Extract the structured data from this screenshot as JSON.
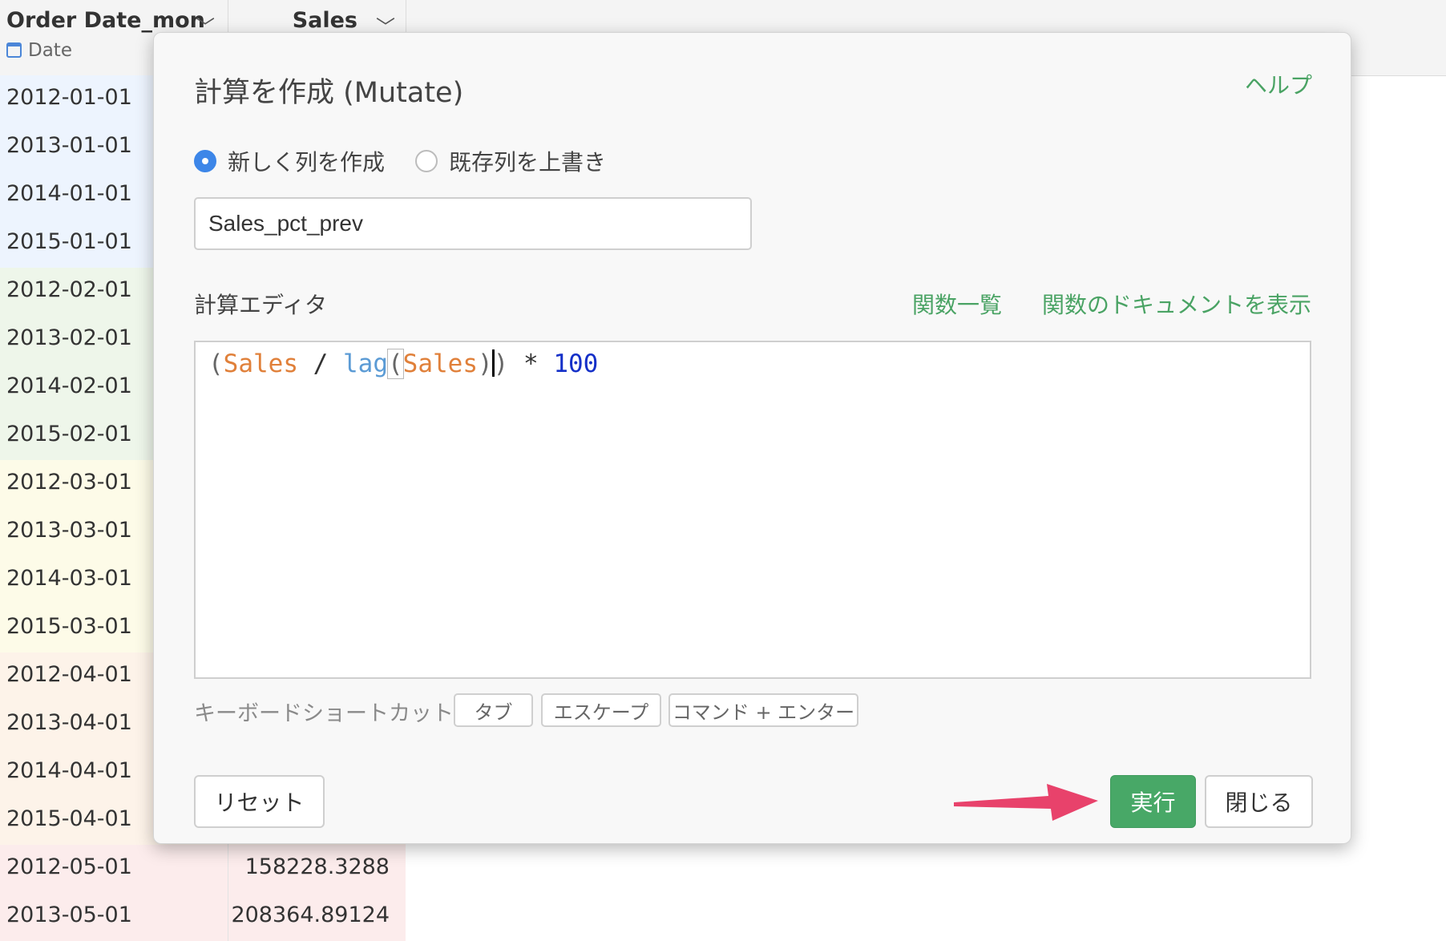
{
  "grid": {
    "columns": [
      {
        "name": "Order Date_mon",
        "type_label": "Date"
      },
      {
        "name": "Sales"
      }
    ],
    "rows": [
      {
        "date": "2012-01-01",
        "sales": "",
        "color": "#edf4fe"
      },
      {
        "date": "2013-01-01",
        "sales": "",
        "color": "#edf4fe"
      },
      {
        "date": "2014-01-01",
        "sales": "",
        "color": "#edf4fe"
      },
      {
        "date": "2015-01-01",
        "sales": "",
        "color": "#edf4fe"
      },
      {
        "date": "2012-02-01",
        "sales": "",
        "color": "#eef6ea"
      },
      {
        "date": "2013-02-01",
        "sales": "",
        "color": "#eef6ea"
      },
      {
        "date": "2014-02-01",
        "sales": "",
        "color": "#eef6ea"
      },
      {
        "date": "2015-02-01",
        "sales": "",
        "color": "#eef6ea"
      },
      {
        "date": "2012-03-01",
        "sales": "",
        "color": "#fdfbe8"
      },
      {
        "date": "2013-03-01",
        "sales": "",
        "color": "#fdfbe8"
      },
      {
        "date": "2014-03-01",
        "sales": "",
        "color": "#fdfbe8"
      },
      {
        "date": "2015-03-01",
        "sales": "",
        "color": "#fdfbe8"
      },
      {
        "date": "2012-04-01",
        "sales": "",
        "color": "#fdf3e9"
      },
      {
        "date": "2013-04-01",
        "sales": "",
        "color": "#fdf3e9"
      },
      {
        "date": "2014-04-01",
        "sales": "",
        "color": "#fdf3e9"
      },
      {
        "date": "2015-04-01",
        "sales": "",
        "color": "#fdf3e9"
      },
      {
        "date": "2012-05-01",
        "sales": "158228.3288",
        "color": "#fcecec"
      },
      {
        "date": "2013-05-01",
        "sales": "208364.89124",
        "color": "#fcecec"
      }
    ]
  },
  "modal": {
    "title": "計算を作成 (Mutate)",
    "help_label": "ヘルプ",
    "radio_new_label": "新しく列を作成",
    "radio_overwrite_label": "既存列を上書き",
    "radio_selected": "new",
    "column_name_value": "Sales_pct_prev",
    "editor_label": "計算エディタ",
    "function_list_label": "関数一覧",
    "function_docs_label": "関数のドキュメントを表示",
    "code": {
      "lp": "(",
      "var1": "Sales",
      "div": " / ",
      "fn": "lag",
      "lp2": "(",
      "var2": "Sales",
      "rp2": ")",
      "rp": ")",
      "mul": " * ",
      "num": "100"
    },
    "shortcut_label": "キーボードショートカット:",
    "shortcuts": [
      "タブ",
      "エスケープ",
      "コマンド + エンター"
    ],
    "reset_label": "リセット",
    "run_label": "実行",
    "close_label": "閉じる"
  },
  "colors": {
    "accent_green": "#48a867",
    "link_green": "#4aa364",
    "radio_blue": "#3d86e8",
    "annotation_arrow": "#e8426b"
  },
  "icons": [
    "calendar-icon",
    "chevron-down-icon",
    "arrow-annotation"
  ]
}
